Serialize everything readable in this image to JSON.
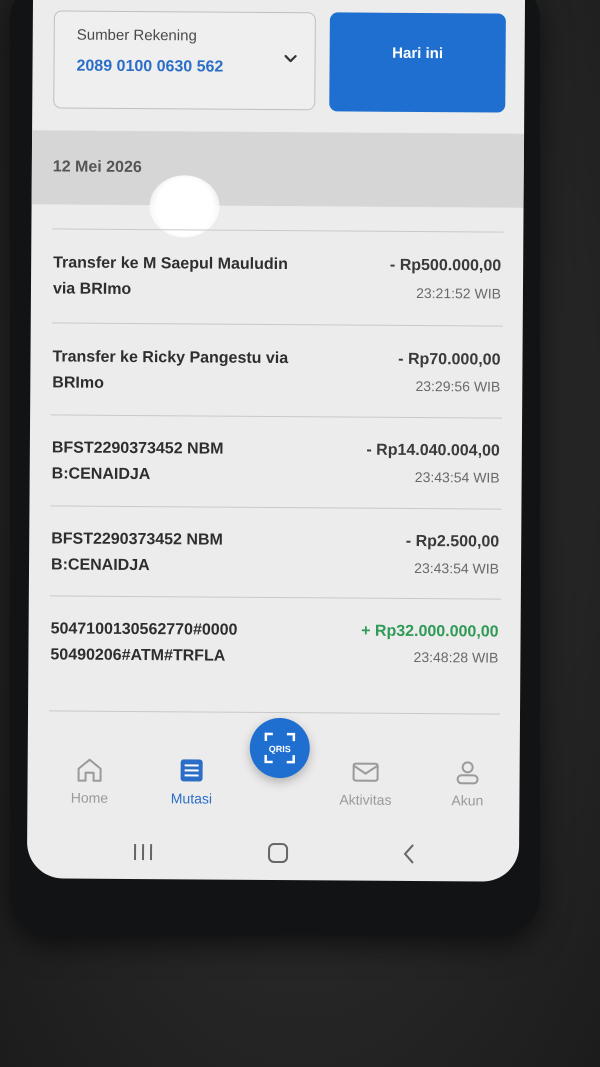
{
  "account": {
    "label": "Sumber Rekening",
    "number": "2089 0100 0630 562"
  },
  "filter": {
    "today_label": "Hari ini"
  },
  "date_header": "12 Mei 2026",
  "transactions": [
    {
      "description": "Transfer ke M Saepul Mauludin via BRImo",
      "amount": "- Rp500.000,00",
      "time": "23:21:52 WIB",
      "type": "debit"
    },
    {
      "description": "Transfer ke Ricky Pangestu via BRImo",
      "amount": "- Rp70.000,00",
      "time": "23:29:56 WIB",
      "type": "debit"
    },
    {
      "description": "BFST2290373452 NBMB:CENAIDJA",
      "amount": "- Rp14.040.004,00",
      "time": "23:43:54 WIB",
      "type": "debit"
    },
    {
      "description": "BFST2290373452 NBMB:CENAIDJA",
      "amount": "- Rp2.500,00",
      "time": "23:43:54 WIB",
      "type": "debit"
    },
    {
      "description": "5047100130562770#000050490206#ATM#TRFLA",
      "amount": "+ Rp32.000.000,00",
      "time": "23:48:28 WIB",
      "type": "credit"
    }
  ],
  "nav": {
    "home": "Home",
    "mutasi": "Mutasi",
    "qris": "QRIS",
    "aktivitas": "Aktivitas",
    "akun": "Akun"
  },
  "colors": {
    "primary": "#1f6fd0",
    "credit": "#2f9a55",
    "active_nav": "#2b6ec7"
  }
}
